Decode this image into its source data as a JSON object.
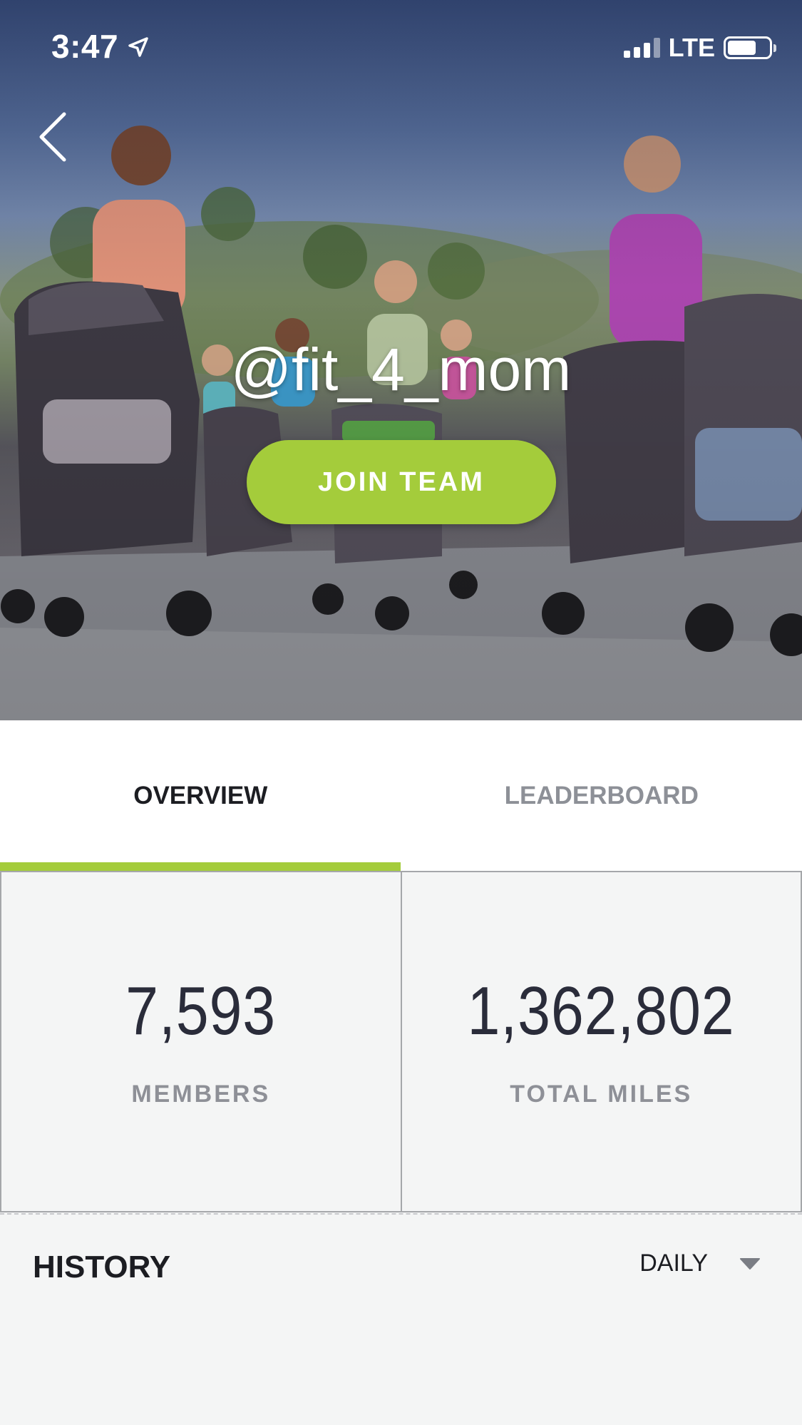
{
  "status_bar": {
    "time": "3:47",
    "network": "LTE"
  },
  "hero": {
    "handle": "@fit_4_mom",
    "join_label": "JOIN TEAM"
  },
  "tabs": [
    {
      "label": "OVERVIEW",
      "active": true
    },
    {
      "label": "LEADERBOARD",
      "active": false
    }
  ],
  "stats": [
    {
      "value": "7,593",
      "label": "MEMBERS"
    },
    {
      "value": "1,362,802",
      "label": "TOTAL MILES"
    }
  ],
  "history": {
    "title": "HISTORY",
    "period": "DAILY"
  },
  "colors": {
    "accent": "#a4cc3b",
    "text_dark": "#1c1d22",
    "text_muted": "#8d9097"
  },
  "icons": [
    "location-arrow-icon",
    "signal-icon",
    "battery-icon",
    "back-chevron-icon",
    "dropdown-caret-icon"
  ]
}
